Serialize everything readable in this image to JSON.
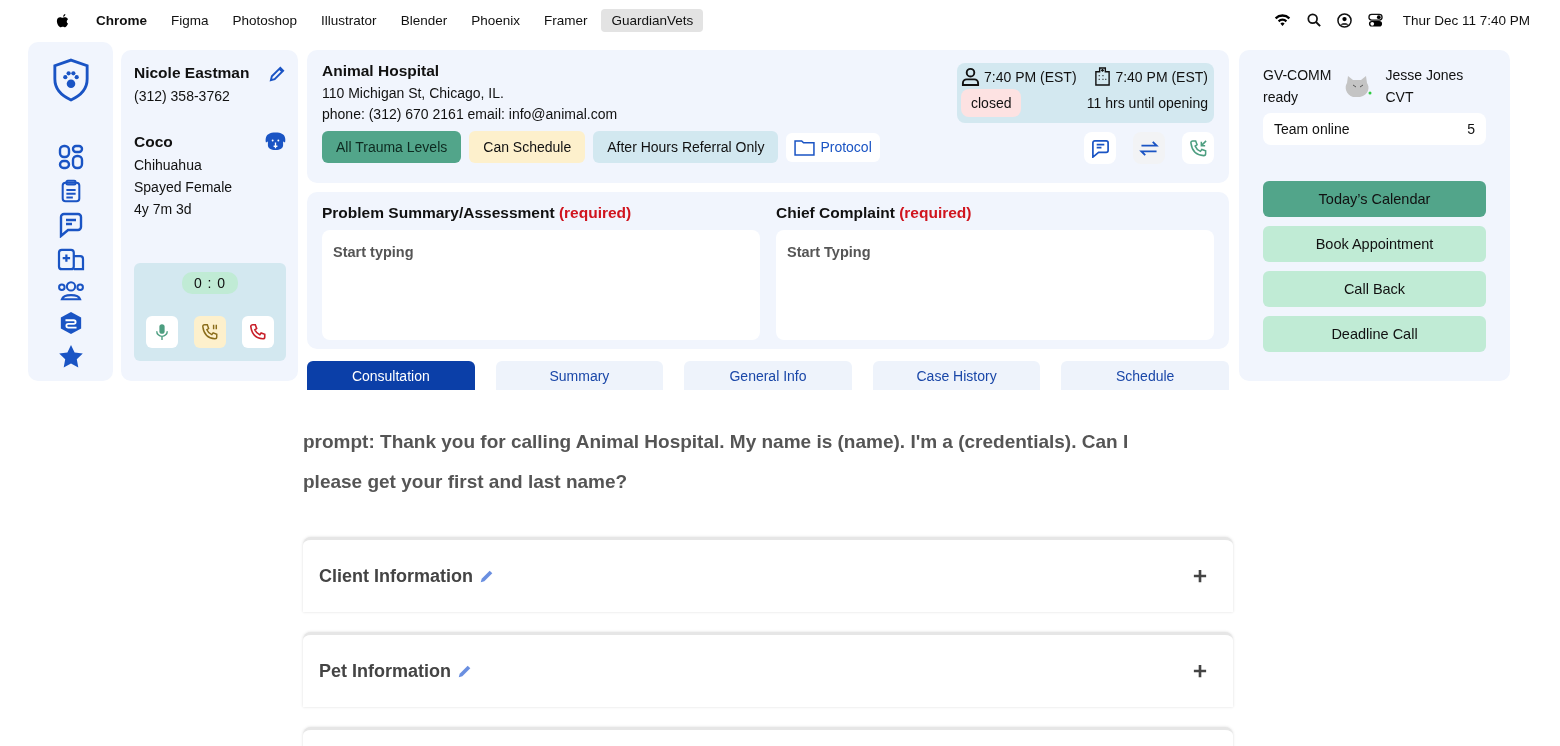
{
  "menubar": {
    "apps": [
      {
        "label": "Chrome",
        "selected": false
      },
      {
        "label": "Figma",
        "selected": false
      },
      {
        "label": "Photoshop",
        "selected": false
      },
      {
        "label": "Illustrator",
        "selected": false
      },
      {
        "label": "Blender",
        "selected": false
      },
      {
        "label": "Phoenix",
        "selected": false
      },
      {
        "label": "Framer",
        "selected": false
      },
      {
        "label": "GuardianVets",
        "selected": true
      }
    ],
    "clock": "Thur Dec 11  7:40 PM"
  },
  "client": {
    "name": "Nicole Eastman",
    "phone": "(312) 358-3762"
  },
  "pet": {
    "name": "Coco",
    "lines": [
      "Chihuahua",
      "Spayed Female",
      "4y 7m 3d"
    ]
  },
  "call": {
    "timer": "0 : 0"
  },
  "hospital": {
    "name": "Animal Hospital",
    "address": "110 Michigan St, Chicago, IL.",
    "contact": "phone: (312) 670 2161  email: info@animal.com",
    "tags": [
      {
        "label": "All Trauma Levels",
        "color": "#52a58a"
      },
      {
        "label": "Can Schedule",
        "color": "#fdf0cc"
      },
      {
        "label": "After Hours Referral Only",
        "color": "#d2e8f0"
      }
    ],
    "protocol": "Protocol",
    "caller_time": "7:40 PM (EST)",
    "hospital_time": "7:40 PM (EST)",
    "status": "closed",
    "until": "11 hrs until opening"
  },
  "notes": [
    {
      "label": "Problem Summary/Assessment",
      "required": "(required)",
      "placeholder": "Start typing"
    },
    {
      "label": "Chief Complaint",
      "required": "(required)",
      "placeholder": "Start Typing"
    }
  ],
  "tabs": [
    {
      "label": "Consultation",
      "selected": true
    },
    {
      "label": "Summary",
      "selected": false
    },
    {
      "label": "General Info",
      "selected": false
    },
    {
      "label": "Case History",
      "selected": false
    },
    {
      "label": "Schedule",
      "selected": false
    }
  ],
  "script": "prompt: Thank you for calling Animal Hospital. My name is (name). I'm a (credentials). Can I please get your first and last name?",
  "sections": [
    {
      "title": "Client Information"
    },
    {
      "title": "Pet Information"
    }
  ],
  "agent": {
    "queue": "GV-COMM",
    "status": "ready",
    "name": "Jesse Jones",
    "role": "CVT",
    "team_label": "Team online",
    "team_count": "5"
  },
  "actions": [
    {
      "label": "Today’s Calendar",
      "selected": true
    },
    {
      "label": "Book Appointment",
      "selected": false
    },
    {
      "label": "Call Back",
      "selected": false
    },
    {
      "label": "Deadline Call",
      "selected": false
    }
  ]
}
